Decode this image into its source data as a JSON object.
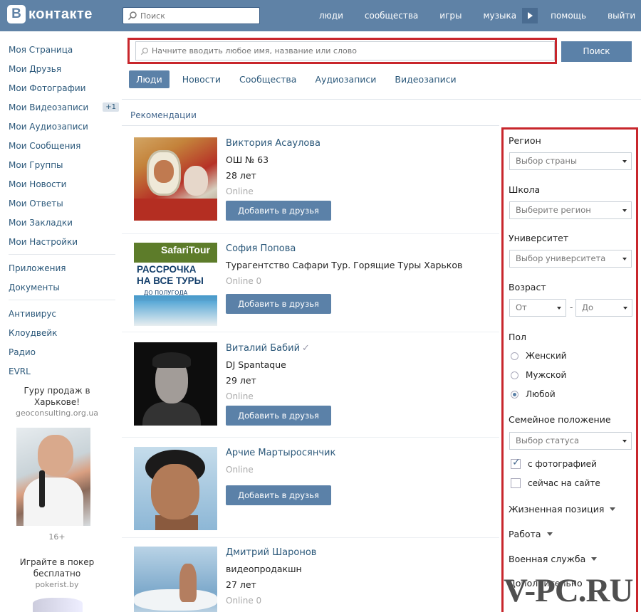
{
  "header": {
    "logo_text": "контакте",
    "logo_letter": "В",
    "search_placeholder": "Поиск",
    "nav": [
      "люди",
      "сообщества",
      "игры",
      "музыка",
      "помощь",
      "выйти"
    ]
  },
  "sidebar": {
    "items": [
      {
        "label": "Моя Страница"
      },
      {
        "label": "Мои Друзья"
      },
      {
        "label": "Мои Фотографии"
      },
      {
        "label": "Мои Видеозаписи",
        "badge": "+1"
      },
      {
        "label": "Мои Аудиозаписи"
      },
      {
        "label": "Мои Сообщения"
      },
      {
        "label": "Мои Группы"
      },
      {
        "label": "Мои Новости"
      },
      {
        "label": "Мои Ответы"
      },
      {
        "label": "Мои Закладки"
      },
      {
        "label": "Мои Настройки"
      }
    ],
    "items2": [
      "Приложения",
      "Документы"
    ],
    "items3": [
      "Антивирус",
      "Клоудвейк",
      "Радио",
      "EVRL"
    ],
    "ad1": {
      "title": "Гуру продаж в Харькове!",
      "sub": "geoconsulting.org.ua",
      "caption": "16+"
    },
    "ad2": {
      "title": "Играйте в покер бесплатно",
      "sub": "pokerist.by"
    }
  },
  "search": {
    "placeholder": "Начните вводить любое имя, название или слово",
    "button": "Поиск"
  },
  "tabs": [
    {
      "label": "Люди",
      "active": true
    },
    {
      "label": "Новости",
      "active": false
    },
    {
      "label": "Сообщества",
      "active": false
    },
    {
      "label": "Аудиозаписи",
      "active": false
    },
    {
      "label": "Видеозаписи",
      "active": false
    }
  ],
  "recommendations_label": "Рекомендации",
  "people": [
    {
      "name": "Виктория Асаулова",
      "line1": "ОШ № 63",
      "line2": "28 лет",
      "status": "Online",
      "button": "Добавить в друзья"
    },
    {
      "name": "София Попова",
      "line1": "Турагентство Сафари Тур. Горящие Туры Харьков",
      "status": "Online",
      "status_detail": "Online 0",
      "button": "Добавить в друзья",
      "photo_text": [
        "SafariTour",
        "РАССРОЧКА",
        "НА ВСЕ ТУРЫ",
        "ДО ПОЛУГОДА"
      ]
    },
    {
      "name": "Виталий Бабий",
      "line1": "DJ Spantaque",
      "line2": "29 лет",
      "status": "Online",
      "button": "Добавить в друзья",
      "verified": true
    },
    {
      "name": "Арчие Мартыросянчик",
      "status": "Online",
      "button": "Добавить в друзья"
    },
    {
      "name": "Дмитрий Шаронов",
      "line1": "видеопродакшн",
      "line2": "27 лет",
      "status": "Online 0"
    }
  ],
  "filters": {
    "region_label": "Регион",
    "region_value": "Выбор страны",
    "school_label": "Школа",
    "school_value": "Выберите регион",
    "university_label": "Университет",
    "university_value": "Выбор университета",
    "age_label": "Возраст",
    "age_from": "От",
    "age_to": "До",
    "age_dash": "-",
    "sex_label": "Пол",
    "sex_options": [
      {
        "label": "Женский",
        "selected": false
      },
      {
        "label": "Мужской",
        "selected": false
      },
      {
        "label": "Любой",
        "selected": true
      }
    ],
    "marital_label": "Семейное положение",
    "marital_value": "Выбор статуса",
    "checkbox_photo": {
      "label": "с фотографией",
      "checked": true
    },
    "checkbox_online": {
      "label": "сейчас на сайте",
      "checked": false
    },
    "expanders": [
      "Жизненная позиция",
      "Работа",
      "Военная служба",
      "Дополнительно"
    ]
  },
  "watermark": "V-PC.RU",
  "colors": {
    "header": "#5f82a6",
    "button": "#5b81a8",
    "link": "#2b587a",
    "highlight_border": "#c8262c"
  }
}
